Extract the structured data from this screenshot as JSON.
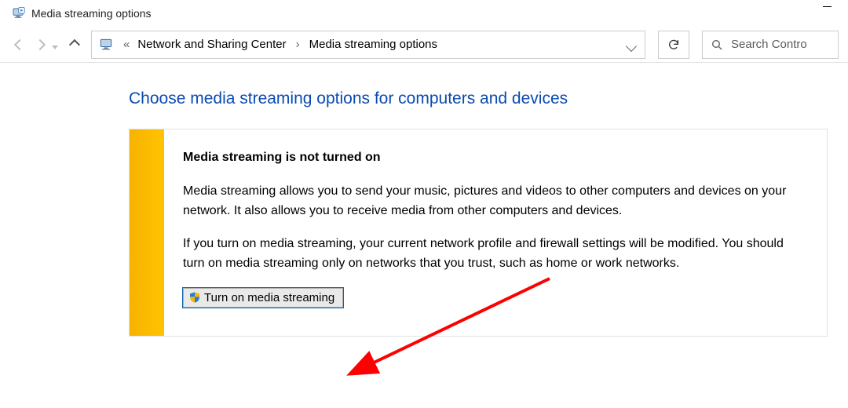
{
  "window": {
    "title": "Media streaming options"
  },
  "breadcrumb": {
    "root": "Network and Sharing Center",
    "current": "Media streaming options"
  },
  "search": {
    "placeholder": "Search Contro"
  },
  "main": {
    "heading": "Choose media streaming options for computers and devices",
    "subtitle": "Media streaming is not turned on",
    "para1": "Media streaming allows you to send your music, pictures and videos to other computers and devices on your network.  It also allows you to receive media from other computers and devices.",
    "para2": "If you turn on media streaming, your current network profile and firewall settings will be modified. You should turn on media streaming only on networks that you trust, such as home or work networks.",
    "button_label": "Turn on media streaming"
  }
}
